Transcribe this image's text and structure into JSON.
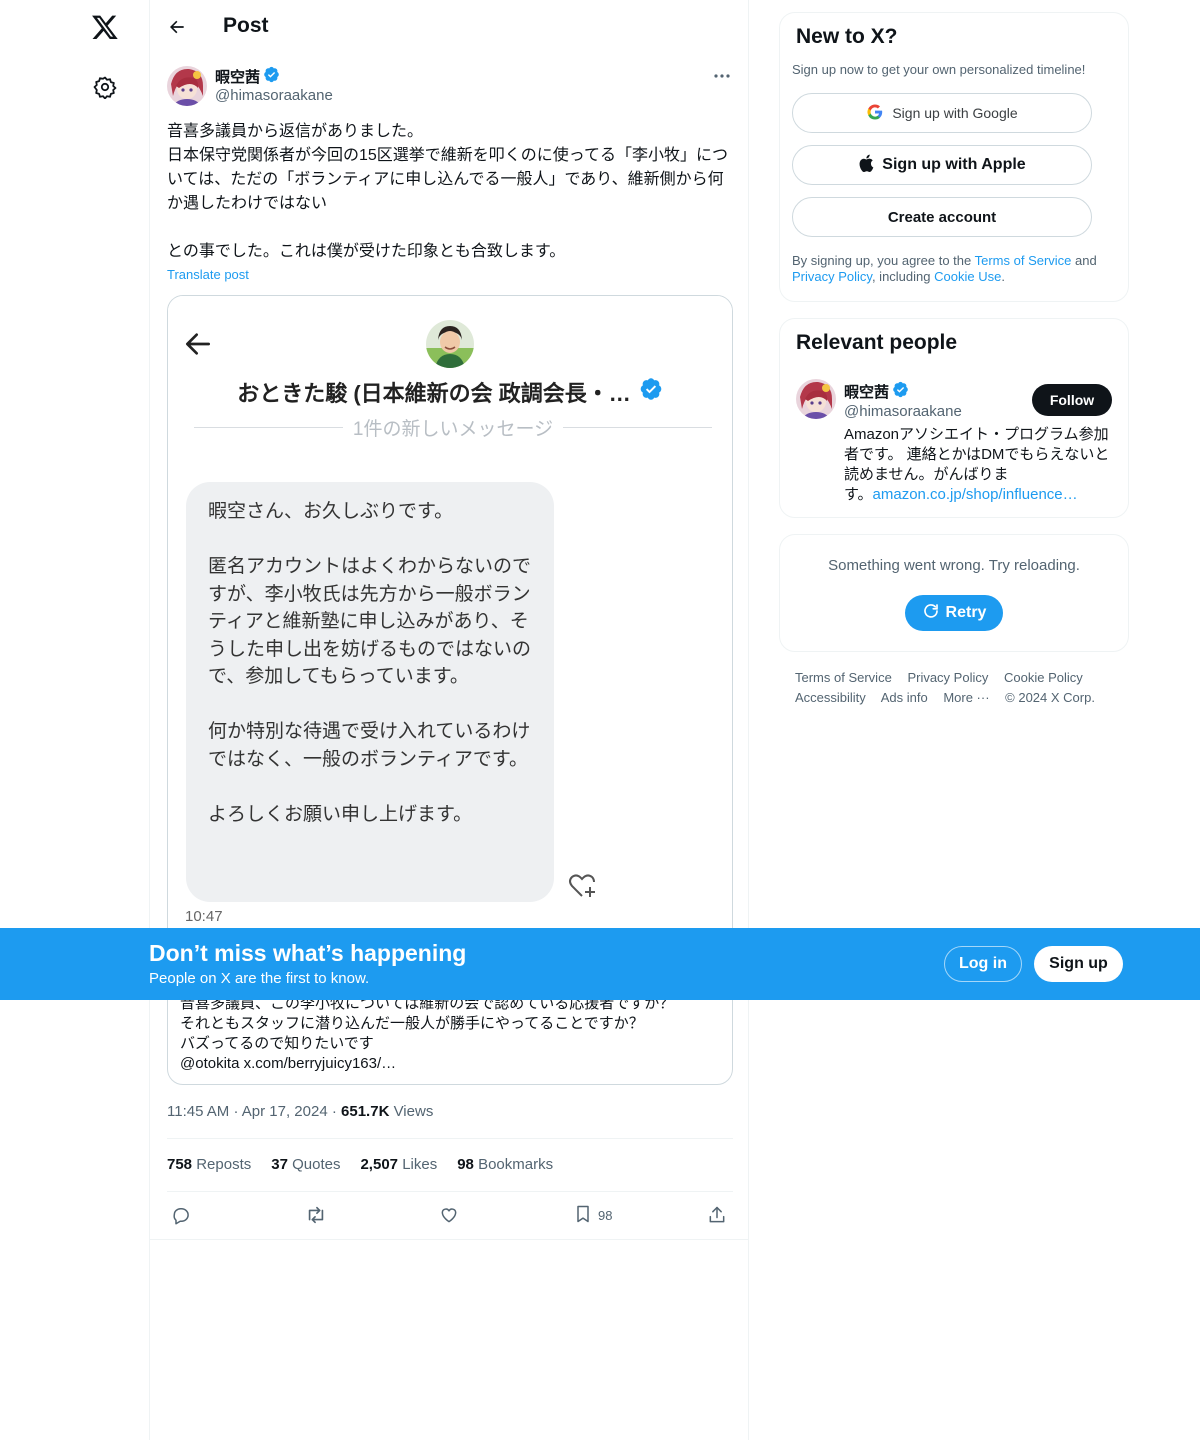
{
  "nav": {
    "logo_icon": "x-logo-icon",
    "settings_icon": "gear-icon"
  },
  "header": {
    "title": "Post"
  },
  "post": {
    "author_name": "暇空茜",
    "author_handle": "@himasoraakane",
    "text": "音喜多議員から返信がありました。\n日本保守党関係者が今回の15区選挙で維新を叩くのに使ってる「李小牧」については、ただの「ボランティアに申し込んでる一般人」であり、維新側から何か遇したわけではない\n\nとの事でした。これは僕が受けた印象とも合致します。",
    "translate_label": "Translate post",
    "quote": {
      "screenshot": {
        "title": "おときた駿 (日本維新の会 政調会長・…",
        "divider_text": "1件の新しいメッセージ",
        "message": "暇空さん、お久しぶりです。\n\n匿名アカウントはよくわからないのですが、李小牧氏は先方から一般ボランティアと維新塾に申し込みがあり、そうした申し出を妨げるものではないので、参加してもらっています。\n\n何か特別な待遇で受け入れているわけではなく、一般のボランティアです。\n\nよろしくお願い申し上げます。",
        "time": "10:47"
      },
      "text": "音喜多議員、この李小牧については維新の会で認めている応援者ですか？\nそれともスタッフに潜り込んだ一般人が勝手にやってることですか？\nバズってるので知りたいです\n@otokita x.com/berryjuicy163/…"
    },
    "time": "11:45 AM",
    "date": "Apr 17, 2024",
    "views_count": "651.7K",
    "views_label": "Views",
    "stats": {
      "reposts_count": "758",
      "reposts_label": "Reposts",
      "quotes_count": "37",
      "quotes_label": "Quotes",
      "likes_count": "2,507",
      "likes_label": "Likes",
      "bookmarks_count": "98",
      "bookmarks_label": "Bookmarks"
    },
    "actions": {
      "reply_icon": "reply-icon",
      "repost_icon": "repost-icon",
      "like_icon": "heart-icon",
      "bookmark_icon": "bookmark-icon",
      "bookmark_count": "98",
      "share_icon": "share-icon"
    }
  },
  "signup_panel": {
    "title": "New to X?",
    "subtitle": "Sign up now to get your own personalized timeline!",
    "google_label": "Sign up with Google",
    "apple_label": "Sign up with Apple",
    "create_label": "Create account",
    "legal_1": "By signing up, you agree to the ",
    "terms": "Terms of Service",
    "legal_2": " and ",
    "privacy": "Privacy Policy",
    "legal_3": ", including ",
    "cookie": "Cookie Use",
    "legal_4": "."
  },
  "relevant_people": {
    "title": "Relevant people",
    "name": "暇空茜",
    "handle": "@himasoraakane",
    "follow_label": "Follow",
    "bio": "Amazonアソシエイト・プログラム参加者です。 連絡とかはDMでもらえないと読めません。がんばりま\nす。",
    "bio_link": "amazon.co.jp/shop/influence…"
  },
  "error_panel": {
    "message": "Something went wrong. Try reloading.",
    "retry_label": "Retry"
  },
  "footer": {
    "links": [
      "Terms of Service",
      "Privacy Policy",
      "Cookie Policy",
      "Accessibility",
      "Ads info",
      "More ···",
      "© 2024 X Corp."
    ]
  },
  "banner": {
    "title": "Don’t miss what’s happening",
    "subtitle": "People on X are the first to know.",
    "login_label": "Log in",
    "signup_label": "Sign up"
  },
  "colors": {
    "accent": "#1d9bf0",
    "text": "#0f1419",
    "muted": "#536471",
    "border": "#eff3f4"
  }
}
